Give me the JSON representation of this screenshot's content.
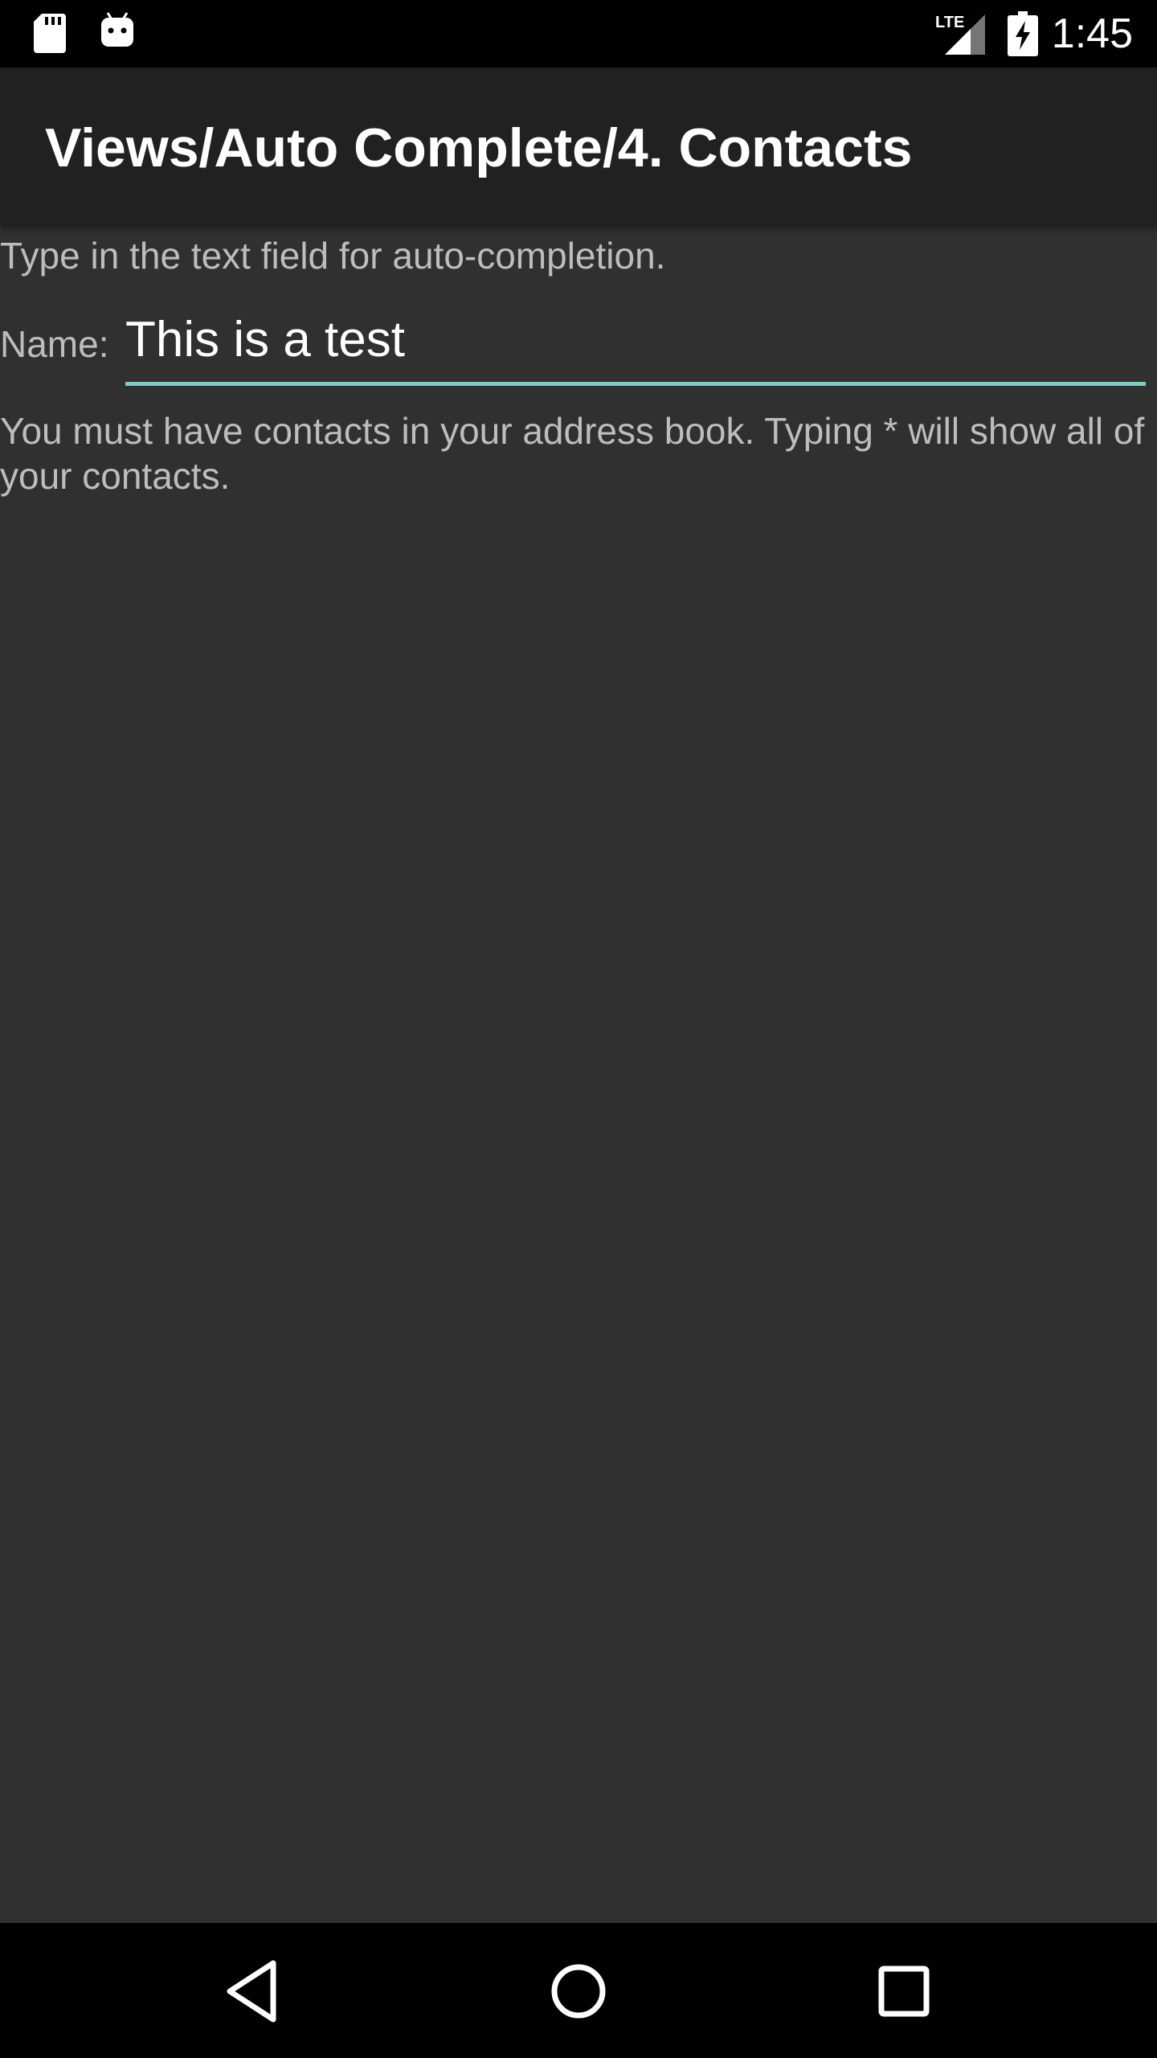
{
  "status_bar": {
    "time": "1:45",
    "network_label": "LTE",
    "icons": [
      "sd-card-icon",
      "android-debug-icon",
      "signal-icon",
      "battery-charging-icon"
    ]
  },
  "app_bar": {
    "title": "Views/Auto Complete/4. Contacts"
  },
  "content": {
    "instruction": "Type in the text field for auto-completion.",
    "name_label": "Name:",
    "name_value": "This is a test",
    "help_text": "You must have contacts in your address book. Typing * will show all of your contacts."
  },
  "nav_bar": {
    "icons": [
      "back-icon",
      "home-icon",
      "recents-icon"
    ]
  },
  "colors": {
    "background": "#303030",
    "app_bar": "#212121",
    "accent": "#80cbc4",
    "text_secondary": "#bdbdbd"
  }
}
